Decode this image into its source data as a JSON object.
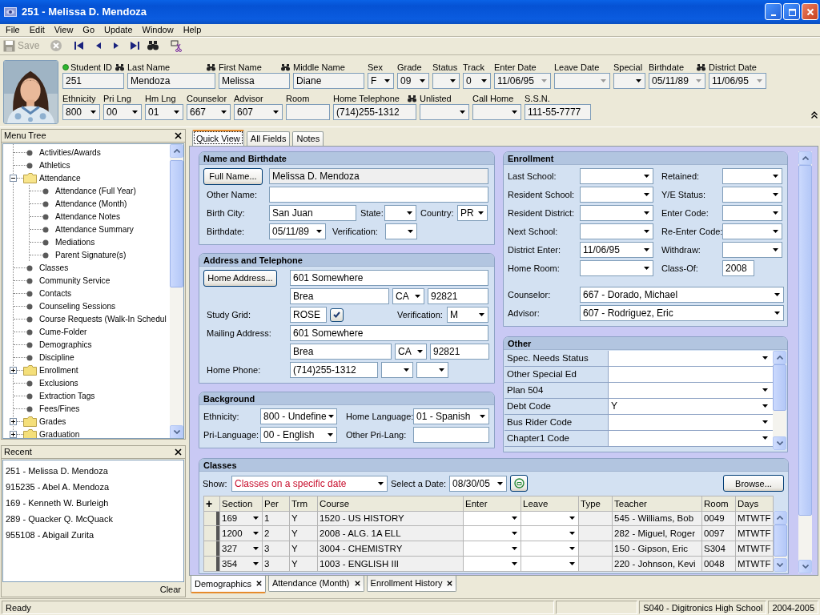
{
  "window": {
    "title": "251 - Melissa D. Mendoza"
  },
  "menu_bar": [
    "File",
    "Edit",
    "View",
    "Go",
    "Update",
    "Window",
    "Help"
  ],
  "toolbar": [
    {
      "kind": "save",
      "label": "Save",
      "disabled": true
    },
    {
      "kind": "cancel",
      "disabled": true
    },
    {
      "kind": "first",
      "disabled": false
    },
    {
      "kind": "previous",
      "disabled": false
    },
    {
      "kind": "next",
      "disabled": false
    },
    {
      "kind": "last",
      "disabled": false
    },
    {
      "kind": "find",
      "disabled": false
    },
    {
      "kind": "cut",
      "disabled": false
    }
  ],
  "student_header": {
    "fields": [
      {
        "label": "Student ID",
        "kind": "id",
        "value": "251",
        "search": true
      },
      {
        "label": "Last Name",
        "kind": "text",
        "value": "Mendoza",
        "search": true
      },
      {
        "label": "First Name",
        "kind": "text",
        "value": "Melissa",
        "search": true
      },
      {
        "label": "Middle Name",
        "kind": "text",
        "value": "Diane",
        "search": false
      },
      {
        "label": "Sex",
        "kind": "combo",
        "value": "F",
        "search": false
      },
      {
        "label": "Grade",
        "kind": "combo",
        "value": "09",
        "search": false
      },
      {
        "label": "Status",
        "kind": "combo",
        "search": false
      },
      {
        "label": "Track",
        "kind": "combo",
        "value": "0",
        "search": false
      },
      {
        "label": "Enter Date",
        "kind": "date",
        "value": "11/06/95",
        "search": false
      },
      {
        "label": "Leave Date",
        "kind": "date",
        "search": false
      },
      {
        "label": "Special",
        "kind": "combo",
        "search": false
      },
      {
        "label": "Birthdate",
        "kind": "date",
        "value": "05/11/89",
        "search": true
      },
      {
        "label": "District Date",
        "kind": "date",
        "value": "11/06/95",
        "search": false
      },
      {
        "label": "Ethnicity",
        "kind": "combo",
        "value": "800",
        "search": false
      },
      {
        "label": "Pri Lng",
        "kind": "combo",
        "value": "00",
        "search": false
      },
      {
        "label": "Hm Lng",
        "kind": "combo",
        "value": "01",
        "search": false
      },
      {
        "label": "Counselor",
        "kind": "combo",
        "value": "667",
        "search": false
      },
      {
        "label": "Advisor",
        "kind": "combo",
        "value": "607",
        "search": false
      },
      {
        "label": "Room",
        "kind": "text",
        "search": false
      },
      {
        "label": "Home Telephone",
        "kind": "text",
        "value": "(714)255-1312",
        "search": true
      },
      {
        "label": "Unlisted",
        "kind": "combo",
        "search": false
      },
      {
        "label": "Call Home",
        "kind": "combo",
        "search": false
      },
      {
        "label": "S.S.N.",
        "kind": "text",
        "value": "111-55-7777",
        "search": false
      }
    ]
  },
  "menu_tree": {
    "title": "Menu Tree",
    "items": [
      {
        "kind": "leaf",
        "label": "Activities/Awards"
      },
      {
        "kind": "leaf",
        "label": "Athletics"
      },
      {
        "kind": "folder",
        "label": "Attendance",
        "expanded": true,
        "children": [
          {
            "kind": "leaf",
            "label": "Attendance (Full Year)"
          },
          {
            "kind": "leaf",
            "label": "Attendance (Month)"
          },
          {
            "kind": "leaf",
            "label": "Attendance Notes"
          },
          {
            "kind": "leaf",
            "label": "Attendance Summary"
          },
          {
            "kind": "leaf",
            "label": "Mediations"
          },
          {
            "kind": "leaf",
            "label": "Parent Signature(s)"
          }
        ]
      },
      {
        "kind": "leaf",
        "label": "Classes"
      },
      {
        "kind": "leaf",
        "label": "Community Service"
      },
      {
        "kind": "leaf",
        "label": "Contacts"
      },
      {
        "kind": "leaf",
        "label": "Counseling Sessions"
      },
      {
        "kind": "leaf",
        "label": "Course Requests (Walk-In Schedul"
      },
      {
        "kind": "leaf",
        "label": "Cume-Folder"
      },
      {
        "kind": "leaf",
        "label": "Demographics"
      },
      {
        "kind": "leaf",
        "label": "Discipline"
      },
      {
        "kind": "folder",
        "label": "Enrollment",
        "expanded": false
      },
      {
        "kind": "leaf",
        "label": "Exclusions"
      },
      {
        "kind": "leaf",
        "label": "Extraction Tags"
      },
      {
        "kind": "leaf",
        "label": "Fees/Fines"
      },
      {
        "kind": "folder",
        "label": "Grades",
        "expanded": false
      },
      {
        "kind": "folder",
        "label": "Graduation",
        "expanded": false
      }
    ]
  },
  "recent": {
    "title": "Recent",
    "items": [
      "251 - Melissa D. Mendoza",
      "915235 - Abel A. Mendoza",
      "169 - Kenneth W. Burleigh",
      "289 - Quacker Q. McQuack",
      "955108 - Abigail Zurita"
    ],
    "clear": "Clear"
  },
  "quick_view": {
    "tabs": [
      {
        "label": "Quick View",
        "selected": true
      },
      {
        "label": "All Fields",
        "selected": false
      },
      {
        "label": "Notes",
        "selected": false
      }
    ],
    "left": [
      {
        "kind": "form",
        "title": "Name and Birthdate",
        "rows": [
          [
            {
              "kind": "button",
              "label": "Full Name..."
            },
            {
              "kind": "readonly",
              "value": "Melissa D. Mendoza"
            }
          ],
          [
            {
              "kind": "label",
              "text": "Other Name:"
            },
            {
              "kind": "text"
            }
          ],
          [
            {
              "kind": "label",
              "text": "Birth City:"
            },
            {
              "kind": "text",
              "value": "San Juan"
            },
            {
              "kind": "label",
              "text": "State:"
            },
            {
              "kind": "combo"
            },
            {
              "kind": "label",
              "text": "Country:"
            },
            {
              "kind": "combo",
              "value": "PR"
            }
          ],
          [
            {
              "kind": "label",
              "text": "Birthdate:"
            },
            {
              "kind": "combo",
              "value": "05/11/89"
            },
            {
              "kind": "label",
              "text": "Verification:"
            },
            {
              "kind": "combo"
            }
          ]
        ]
      },
      {
        "kind": "form",
        "title": "Address and Telephone",
        "rows": [
          [
            {
              "kind": "button",
              "label": "Home Address..."
            },
            {
              "kind": "text",
              "value": "601 Somewhere"
            }
          ],
          [
            {
              "kind": "text",
              "value": "Brea"
            },
            {
              "kind": "combo",
              "value": "CA"
            },
            {
              "kind": "text",
              "value": "92821"
            }
          ],
          [
            {
              "kind": "label",
              "text": "Study Grid:"
            },
            {
              "kind": "text",
              "value": "ROSE"
            },
            {
              "kind": "check",
              "checked": true
            },
            {
              "kind": "label",
              "text": "Verification:"
            },
            {
              "kind": "combo",
              "value": "M"
            }
          ],
          [
            {
              "kind": "label",
              "text": "Mailing Address:"
            },
            {
              "kind": "text",
              "value": "601 Somewhere"
            }
          ],
          [
            {
              "kind": "text",
              "value": "Brea"
            },
            {
              "kind": "combo",
              "value": "CA"
            },
            {
              "kind": "text",
              "value": "92821"
            }
          ],
          [
            {
              "kind": "label",
              "text": "Home Phone:"
            },
            {
              "kind": "text",
              "value": "(714)255-1312"
            },
            {
              "kind": "combo"
            },
            {
              "kind": "combo"
            }
          ]
        ]
      },
      {
        "kind": "form",
        "title": "Background",
        "rows": [
          [
            {
              "kind": "label",
              "text": "Ethnicity:"
            },
            {
              "kind": "combo",
              "value": "800 - Undefine"
            },
            {
              "kind": "label",
              "text": "Home Language:"
            },
            {
              "kind": "combo",
              "value": "01 - Spanish"
            }
          ],
          [
            {
              "kind": "label",
              "text": "Pri-Language:"
            },
            {
              "kind": "combo",
              "value": "00 - English"
            },
            {
              "kind": "label",
              "text": "Other Pri-Lang:"
            },
            {
              "kind": "text"
            }
          ]
        ]
      }
    ],
    "right": [
      {
        "kind": "form",
        "title": "Enrollment",
        "rows": [
          [
            {
              "kind": "label",
              "text": "Last School:"
            },
            {
              "kind": "combo"
            },
            {
              "kind": "label",
              "text": "Retained:"
            },
            {
              "kind": "combo"
            }
          ],
          [
            {
              "kind": "label",
              "text": "Resident School:"
            },
            {
              "kind": "combo"
            },
            {
              "kind": "label",
              "text": "Y/E Status:"
            },
            {
              "kind": "combo"
            }
          ],
          [
            {
              "kind": "label",
              "text": "Resident District:"
            },
            {
              "kind": "combo"
            },
            {
              "kind": "label",
              "text": "Enter Code:"
            },
            {
              "kind": "combo"
            }
          ],
          [
            {
              "kind": "label",
              "text": "Next School:"
            },
            {
              "kind": "combo"
            },
            {
              "kind": "label",
              "text": "Re-Enter Code:"
            },
            {
              "kind": "combo"
            }
          ],
          [
            {
              "kind": "label",
              "text": "District Enter:"
            },
            {
              "kind": "combo",
              "value": "11/06/95"
            },
            {
              "kind": "label",
              "text": "Withdraw:"
            },
            {
              "kind": "combo"
            }
          ],
          [
            {
              "kind": "label",
              "text": "Home Room:"
            },
            {
              "kind": "combo"
            },
            {
              "kind": "label",
              "text": "Class-Of:"
            },
            {
              "kind": "text",
              "value": "2008"
            }
          ],
          [
            {
              "kind": "label",
              "text": "Counselor:"
            },
            {
              "kind": "combo",
              "value": "667 - Dorado, Michael"
            }
          ],
          [
            {
              "kind": "label",
              "text": "Advisor:"
            },
            {
              "kind": "combo",
              "value": "607 - Rodriguez, Eric"
            }
          ]
        ]
      },
      {
        "kind": "grid",
        "title": "Other",
        "rows": [
          {
            "label": "Spec. Needs Status",
            "kind": "combo"
          },
          {
            "label": "Other Special Ed",
            "kind": "text"
          },
          {
            "label": "Plan 504",
            "kind": "combo"
          },
          {
            "label": "Debt Code",
            "kind": "combo",
            "value": "Y"
          },
          {
            "label": "Bus Rider Code",
            "kind": "combo"
          },
          {
            "label": "Chapter1 Code",
            "kind": "combo"
          }
        ]
      }
    ],
    "classes": {
      "kind": "classes",
      "title": "Classes",
      "show_label": "Show:",
      "show_value": "Classes on a specific date",
      "date_label": "Select a Date:",
      "date_value": "08/30/05",
      "browse": "Browse...",
      "add": "+",
      "columns": [
        "Section",
        "Per",
        "Trm",
        "Course",
        "Enter",
        "Leave",
        "Type",
        "Teacher",
        "Room",
        "Days"
      ],
      "rows": [
        {
          "section": "169",
          "per": "1",
          "term": "Y",
          "course": "1520 - US HISTORY",
          "teacher": "545 - Williams, Bob",
          "room": "0049",
          "days": "MTWTF"
        },
        {
          "section": "1200",
          "per": "2",
          "term": "Y",
          "course": "2008 - ALG. 1A ELL",
          "teacher": "282 - Miguel, Roger",
          "room": "0097",
          "days": "MTWTF"
        },
        {
          "section": "327",
          "per": "3",
          "term": "Y",
          "course": "3004 - CHEMISTRY",
          "teacher": "150 - Gipson, Eric",
          "room": "S304",
          "days": "MTWTF"
        },
        {
          "section": "354",
          "per": "3",
          "term": "Y",
          "course": "1003 - ENGLISH III",
          "teacher": "220 - Johnson, Kevi",
          "room": "0048",
          "days": "MTWTF"
        }
      ]
    }
  },
  "doc_tabs": [
    {
      "label": "Demographics",
      "selected": true
    },
    {
      "label": "Attendance (Month)",
      "selected": false
    },
    {
      "label": "Enrollment History",
      "selected": false
    }
  ],
  "status_bar": {
    "message": "Ready",
    "school": "S040 - Digitronics High School",
    "year": "2004-2005"
  }
}
